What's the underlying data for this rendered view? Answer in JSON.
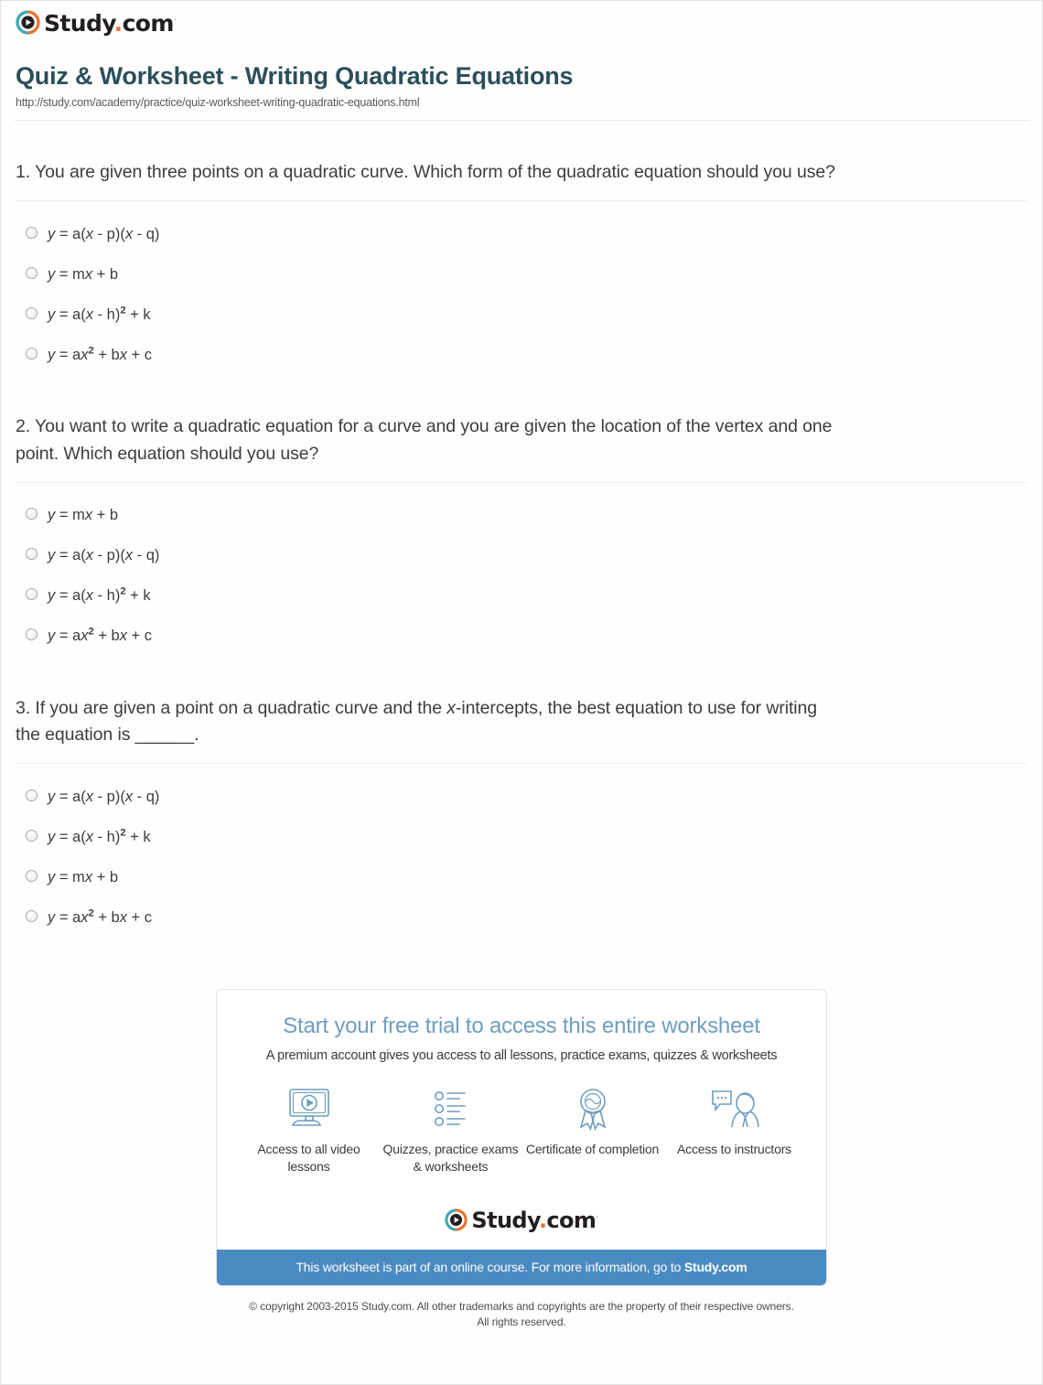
{
  "brand": {
    "name_main": "Study",
    "name_dot": ".",
    "name_tld": "com",
    "trademark": "·",
    "logo_icon": "play-circle-icon",
    "colors": {
      "teal": "#3fa9b5",
      "orange": "#e8762c",
      "title": "#2b4f5b",
      "promo_bar": "#4a8ac2",
      "promo_head": "#6f9dc0"
    }
  },
  "header": {
    "title": "Quiz & Worksheet - Writing Quadratic Equations",
    "url": "http://study.com/academy/practice/quiz-worksheet-writing-quadratic-equations.html"
  },
  "questions": [
    {
      "number": "1.",
      "text": "1. You are given three points on a quadratic curve. Which form of the quadratic equation should you use?",
      "answers": [
        {
          "id": "q1-a",
          "html": "<i>y</i> = a(<i>x</i> - p)(<i>x</i> - q)",
          "plain": "y = a(x - p)(x - q)"
        },
        {
          "id": "q1-b",
          "html": "<i>y</i> = m<i>x</i> + b",
          "plain": "y = mx + b"
        },
        {
          "id": "q1-c",
          "html": "<i>y</i> = a(<i>x</i> - h)<sup>2</sup> + k",
          "plain": "y = a(x - h)2 + k"
        },
        {
          "id": "q1-d",
          "html": "<i>y</i> = a<i>x</i><sup>2</sup> + b<i>x</i> + c",
          "plain": "y = ax2 + bx + c"
        }
      ]
    },
    {
      "number": "2.",
      "text": "2. You want to write a quadratic equation for a curve and you are given the location of the vertex and one point. Which equation should you use?",
      "answers": [
        {
          "id": "q2-a",
          "html": "<i>y</i> = m<i>x</i> + b",
          "plain": "y = mx + b"
        },
        {
          "id": "q2-b",
          "html": "<i>y</i> = a(<i>x</i> - p)(<i>x</i> - q)",
          "plain": "y = a(x - p)(x - q)"
        },
        {
          "id": "q2-c",
          "html": "<i>y</i> = a(<i>x</i> - h)<sup>2</sup> + k",
          "plain": "y = a(x - h)2 + k"
        },
        {
          "id": "q2-d",
          "html": "<i>y</i> = a<i>x</i><sup>2</sup> + b<i>x</i> + c",
          "plain": "y = ax2 + bx + c"
        }
      ]
    },
    {
      "number": "3.",
      "text_html": "3. If you are given a point on a quadratic curve and the <i>x</i>-intercepts, the best equation to use for writing the equation is ______.",
      "text": "3. If you are given a point on a quadratic curve and the x-intercepts, the best equation to use for writing the equation is ______.",
      "answers": [
        {
          "id": "q3-a",
          "html": "<i>y</i> = a(<i>x</i> - p)(<i>x</i> - q)",
          "plain": "y = a(x - p)(x - q)"
        },
        {
          "id": "q3-b",
          "html": "<i>y</i> = a(<i>x</i> - h)<sup>2</sup> + k",
          "plain": "y = a(x - h)2 + k"
        },
        {
          "id": "q3-c",
          "html": "<i>y</i> = m<i>x</i> + b",
          "plain": "y = mx + b"
        },
        {
          "id": "q3-d",
          "html": "<i>y</i> = a<i>x</i><sup>2</sup> + b<i>x</i> + c",
          "plain": "y = ax2 + bx + c"
        }
      ]
    }
  ],
  "promo": {
    "heading": "Start your free trial to access this entire worksheet",
    "subheading": "A premium account gives you access to all lessons, practice exams, quizzes & worksheets",
    "features": [
      {
        "icon": "monitor-play-icon",
        "label": "Access to all video lessons"
      },
      {
        "icon": "checklist-icon",
        "label": "Quizzes, practice exams & worksheets"
      },
      {
        "icon": "award-ribbon-icon",
        "label": "Certificate of completion"
      },
      {
        "icon": "instructor-chat-icon",
        "label": "Access to instructors"
      }
    ],
    "bar_text_prefix": "This worksheet is part of an online course. For more information, go to ",
    "bar_link": "Study.com"
  },
  "footer": {
    "line1": "© copyright 2003-2015 Study.com. All other trademarks and copyrights are the property of their respective owners.",
    "line2": "All rights reserved."
  }
}
